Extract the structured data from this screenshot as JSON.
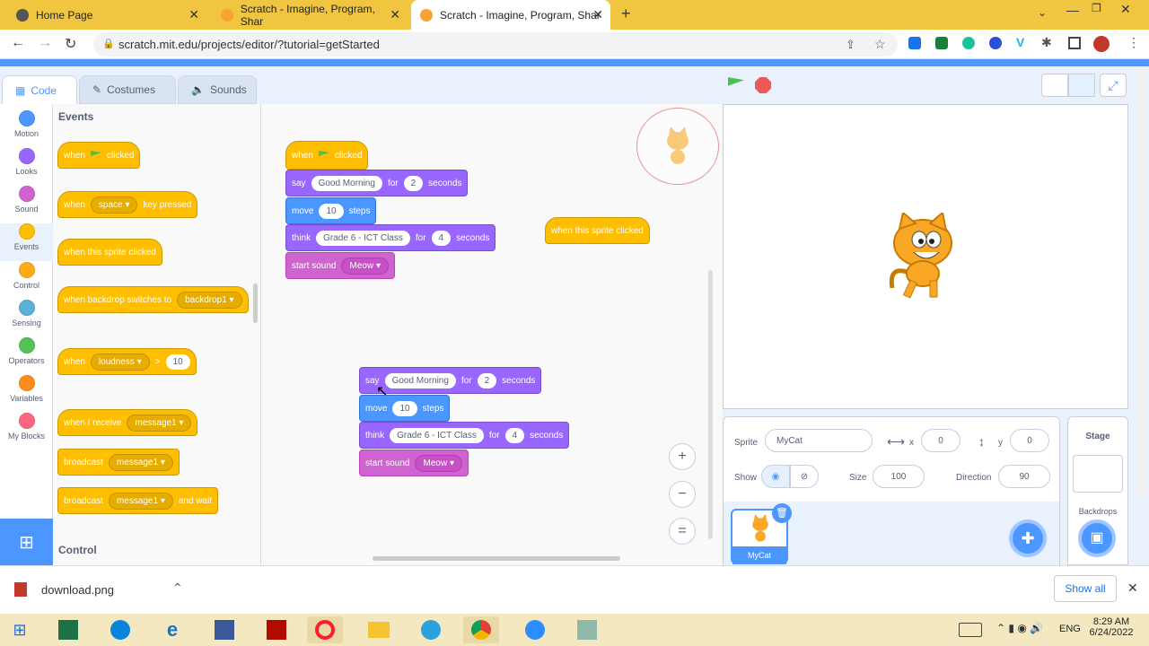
{
  "browser": {
    "tabs": [
      {
        "title": "Home Page"
      },
      {
        "title": "Scratch - Imagine, Program, Shar"
      },
      {
        "title": "Scratch - Imagine, Program, Shar"
      }
    ],
    "url": "scratch.mit.edu/projects/editor/?tutorial=getStarted"
  },
  "editor_tabs": {
    "code": "Code",
    "costumes": "Costumes",
    "sounds": "Sounds"
  },
  "categories": [
    {
      "label": "Motion",
      "color": "#4c97ff"
    },
    {
      "label": "Looks",
      "color": "#9966ff"
    },
    {
      "label": "Sound",
      "color": "#cf63cf"
    },
    {
      "label": "Events",
      "color": "#ffbf00"
    },
    {
      "label": "Control",
      "color": "#ffab19"
    },
    {
      "label": "Sensing",
      "color": "#5cb1d6"
    },
    {
      "label": "Operators",
      "color": "#59c059"
    },
    {
      "label": "Variables",
      "color": "#ff8c1a"
    },
    {
      "label": "My Blocks",
      "color": "#ff6680"
    }
  ],
  "palette": {
    "heading": "Events",
    "heading2": "Control",
    "when": "when",
    "clicked": "clicked",
    "space": "space",
    "key_pressed": "key pressed",
    "when_sprite_clicked": "when this sprite clicked",
    "when_backdrop_switches": "when backdrop switches to",
    "backdrop1": "backdrop1",
    "loudness": "loudness",
    "gt": ">",
    "ten": "10",
    "when_i_receive": "when I receive",
    "message1": "message1",
    "broadcast": "broadcast",
    "and_wait": "and wait"
  },
  "script": {
    "when": "when",
    "clicked": "clicked",
    "say": "say",
    "good_morning": "Good Morning",
    "for": "for",
    "two": "2",
    "seconds": "seconds",
    "move": "move",
    "ten": "10",
    "steps": "steps",
    "think": "think",
    "grade": "Grade 6 - ICT Class",
    "four": "4",
    "start_sound": "start sound",
    "meow": "Meow",
    "when_sprite_clicked": "when this sprite clicked"
  },
  "zoom": {
    "in": "+",
    "out": "−",
    "reset": "="
  },
  "sprite": {
    "label": "Sprite",
    "name": "MyCat",
    "x_label": "x",
    "x": "0",
    "y_label": "y",
    "y": "0",
    "show_label": "Show",
    "size_label": "Size",
    "size": "100",
    "direction_label": "Direction",
    "direction": "90",
    "thumb_name": "MyCat"
  },
  "stage_pane": {
    "title": "Stage",
    "backdrops": "Backdrops"
  },
  "download": {
    "file": "download.png",
    "show_all": "Show all"
  },
  "taskbar": {
    "lang": "ENG",
    "time": "8:29 AM",
    "date": "6/24/2022"
  }
}
